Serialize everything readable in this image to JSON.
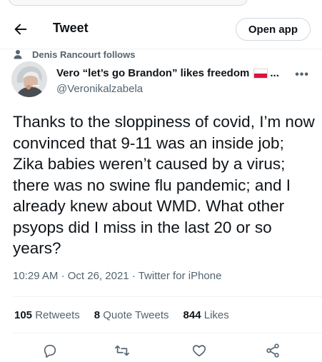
{
  "header": {
    "title": "Tweet",
    "open_app_label": "Open app"
  },
  "social_context": {
    "text": "Denis Rancourt follows"
  },
  "author": {
    "name": "Vero “let’s go Brandon” likes freedom",
    "name_suffix": "...",
    "handle": "@Veronikalzabela"
  },
  "tweet": {
    "text": "Thanks to the sloppiness of covid, I’m now convinced that 9-11 was an inside job; Zika babies weren’t caused by a virus; there was no swine flu pandemic; and I already knew about WMD. What other psyops did I miss in the last 20 or so years?",
    "time": "10:29 AM",
    "date": "Oct 26, 2021",
    "source": "Twitter for iPhone"
  },
  "stats": {
    "retweets_count": "105",
    "retweets_label": "Retweets",
    "quotes_count": "8",
    "quotes_label": "Quote Tweets",
    "likes_count": "844",
    "likes_label": "Likes"
  },
  "icons": {
    "back": "arrow-left-icon",
    "person": "person-icon",
    "more": "more-icon",
    "reply": "reply-icon",
    "retweet": "retweet-icon",
    "like": "heart-icon",
    "share": "share-icon",
    "flag": "poland-flag-icon"
  },
  "colors": {
    "text": "#0f1419",
    "secondary": "#536471",
    "border": "#cfd9de"
  }
}
